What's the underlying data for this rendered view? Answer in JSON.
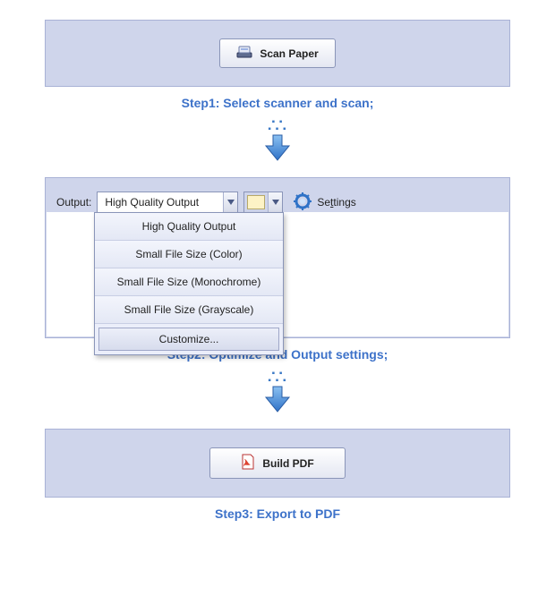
{
  "step1": {
    "button_label": "Scan Paper",
    "caption": "Step1: Select scanner and scan;"
  },
  "step2": {
    "output_label": "Output:",
    "selected": "High Quality Output",
    "settings_prefix": "Se",
    "settings_underline": "t",
    "settings_suffix": "tings",
    "options": [
      "High Quality Output",
      "Small File Size (Color)",
      "Small File Size (Monochrome)",
      "Small File Size (Grayscale)",
      "Customize..."
    ],
    "swatch_color": "#fdf3c6",
    "caption": "Step2: Optimize and Output settings;"
  },
  "step3": {
    "button_label": "Build PDF",
    "caption": "Step3: Export to PDF"
  }
}
